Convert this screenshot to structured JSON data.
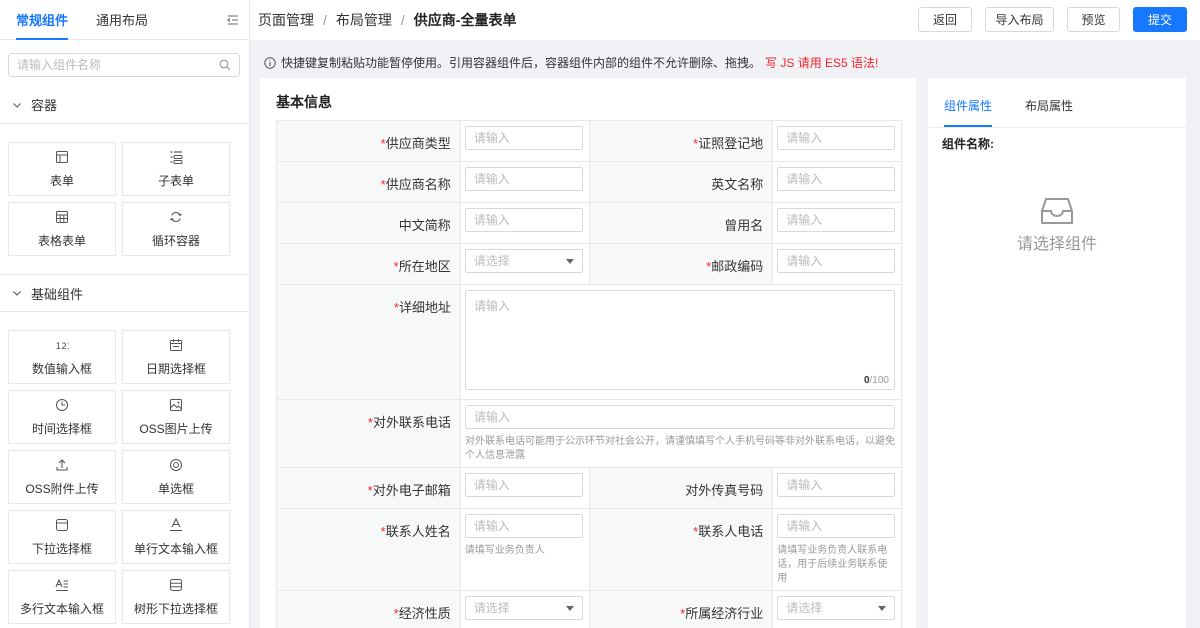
{
  "sidebar": {
    "tabs": [
      {
        "label": "常规组件"
      },
      {
        "label": "通用布局"
      }
    ],
    "search_placeholder": "请输入组件名称",
    "groups": [
      {
        "title": "容器",
        "items": [
          {
            "label": "表单",
            "icon": "form-icon"
          },
          {
            "label": "子表单",
            "icon": "sub-form-icon"
          },
          {
            "label": "表格表单",
            "icon": "table-form-icon"
          },
          {
            "label": "循环容器",
            "icon": "loop-container-icon"
          }
        ]
      },
      {
        "title": "基础组件",
        "items": [
          {
            "label": "数值输入框",
            "icon": "number-icon"
          },
          {
            "label": "日期选择框",
            "icon": "calendar-icon"
          },
          {
            "label": "时间选择框",
            "icon": "clock-icon"
          },
          {
            "label": "OSS图片上传",
            "icon": "image-icon"
          },
          {
            "label": "OSS附件上传",
            "icon": "upload-icon"
          },
          {
            "label": "单选框",
            "icon": "radio-icon"
          },
          {
            "label": "下拉选择框",
            "icon": "select-icon"
          },
          {
            "label": "单行文本输入框",
            "icon": "text-input-icon"
          },
          {
            "label": "多行文本输入框",
            "icon": "textarea-icon"
          },
          {
            "label": "树形下拉选择框",
            "icon": "tree-select-icon"
          }
        ]
      }
    ]
  },
  "header": {
    "breadcrumb": [
      "页面管理",
      "布局管理",
      "供应商-全量表单"
    ],
    "buttons": {
      "back": "返回",
      "import": "导入布局",
      "preview": "预览",
      "submit": "提交"
    }
  },
  "notice": {
    "text": "快捷键复制粘贴功能暂停使用。引用容器组件后，容器组件内部的组件不允许删除、拖拽。",
    "warning": "写 JS 请用 ES5 语法!"
  },
  "form": {
    "title": "基本信息",
    "input_placeholder": "请输入",
    "select_placeholder": "请选择",
    "fields": {
      "supplier_type": "供应商类型",
      "license_place": "证照登记地",
      "supplier_name": "供应商名称",
      "english_name": "英文名称",
      "chinese_abbr": "中文简称",
      "former_name": "曾用名",
      "region": "所在地区",
      "postal_code": "邮政编码",
      "address": "详细地址",
      "address_count": "0",
      "address_max": "/100",
      "public_phone": "对外联系电话",
      "public_phone_help": "对外联系电话可能用于公示环节对社会公开，请谨慎填写个人手机号码等非对外联系电话，以避免个人信息泄露",
      "public_email": "对外电子邮箱",
      "public_fax": "对外传真号码",
      "contact_name": "联系人姓名",
      "contact_name_help": "请填写业务负责人",
      "contact_phone": "联系人电话",
      "contact_phone_help": "请填写业务负责人联系电话，用于后续业务联系使用",
      "economic_nature": "经济性质",
      "industry": "所属经济行业"
    }
  },
  "props": {
    "tabs": [
      {
        "label": "组件属性"
      },
      {
        "label": "布局属性"
      }
    ],
    "name_label": "组件名称:",
    "empty_text": "请选择组件"
  }
}
